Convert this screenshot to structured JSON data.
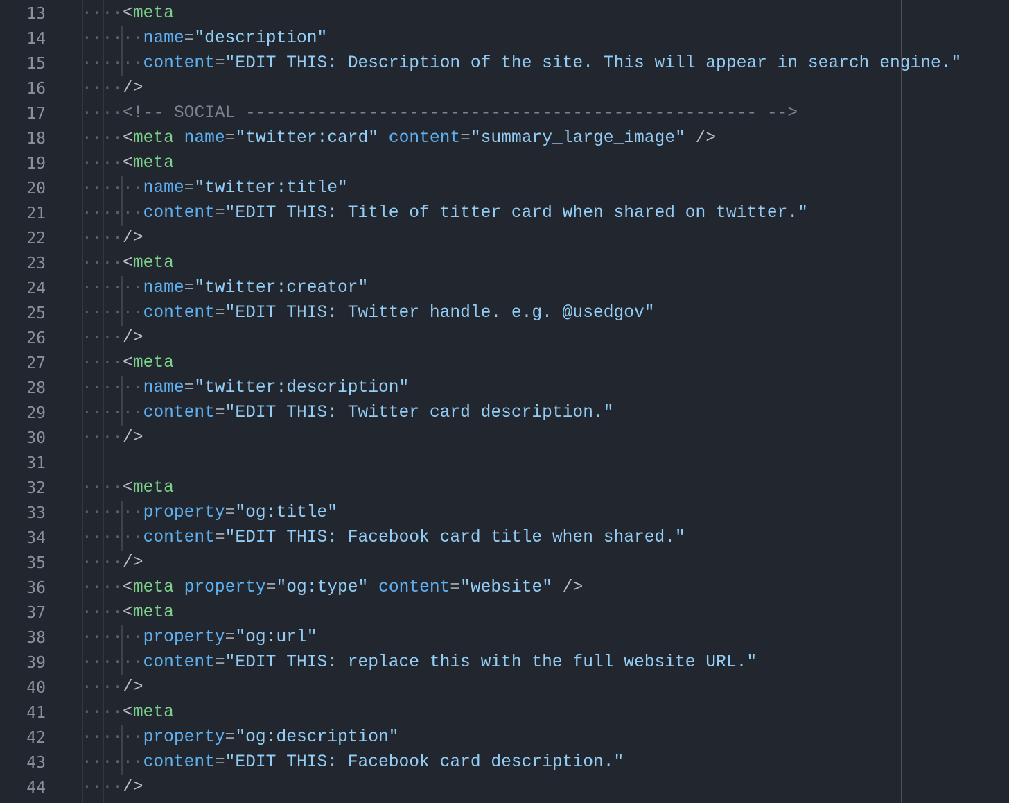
{
  "editor": {
    "first_line_number": 13,
    "lines": [
      {
        "n": "13",
        "indent": 4,
        "tokens": [
          [
            "p",
            "<"
          ],
          [
            "tag",
            "meta"
          ]
        ]
      },
      {
        "n": "14",
        "indent": 6,
        "tokens": [
          [
            "attr",
            "name"
          ],
          [
            "eq",
            "="
          ],
          [
            "str",
            "\"description\""
          ]
        ]
      },
      {
        "n": "15",
        "indent": 6,
        "tokens": [
          [
            "attr",
            "content"
          ],
          [
            "eq",
            "="
          ],
          [
            "str",
            "\"EDIT THIS: Description of the site. This will appear in search engine.\""
          ]
        ]
      },
      {
        "n": "16",
        "indent": 4,
        "tokens": [
          [
            "p",
            "/>"
          ]
        ]
      },
      {
        "n": "17",
        "indent": 4,
        "tokens": [
          [
            "cmt",
            "<!-- SOCIAL -------------------------------------------------- -->"
          ]
        ]
      },
      {
        "n": "18",
        "indent": 4,
        "tokens": [
          [
            "p",
            "<"
          ],
          [
            "tag",
            "meta"
          ],
          [
            "p",
            " "
          ],
          [
            "attr",
            "name"
          ],
          [
            "eq",
            "="
          ],
          [
            "str",
            "\"twitter:card\""
          ],
          [
            "p",
            " "
          ],
          [
            "attr",
            "content"
          ],
          [
            "eq",
            "="
          ],
          [
            "str",
            "\"summary_large_image\""
          ],
          [
            "p",
            " />"
          ]
        ]
      },
      {
        "n": "19",
        "indent": 4,
        "tokens": [
          [
            "p",
            "<"
          ],
          [
            "tag",
            "meta"
          ]
        ]
      },
      {
        "n": "20",
        "indent": 6,
        "tokens": [
          [
            "attr",
            "name"
          ],
          [
            "eq",
            "="
          ],
          [
            "str",
            "\"twitter:title\""
          ]
        ]
      },
      {
        "n": "21",
        "indent": 6,
        "tokens": [
          [
            "attr",
            "content"
          ],
          [
            "eq",
            "="
          ],
          [
            "str",
            "\"EDIT THIS: Title of titter card when shared on twitter.\""
          ]
        ]
      },
      {
        "n": "22",
        "indent": 4,
        "tokens": [
          [
            "p",
            "/>"
          ]
        ]
      },
      {
        "n": "23",
        "indent": 4,
        "tokens": [
          [
            "p",
            "<"
          ],
          [
            "tag",
            "meta"
          ]
        ]
      },
      {
        "n": "24",
        "indent": 6,
        "tokens": [
          [
            "attr",
            "name"
          ],
          [
            "eq",
            "="
          ],
          [
            "str",
            "\"twitter:creator\""
          ]
        ]
      },
      {
        "n": "25",
        "indent": 6,
        "tokens": [
          [
            "attr",
            "content"
          ],
          [
            "eq",
            "="
          ],
          [
            "str",
            "\"EDIT THIS: Twitter handle. e.g. @usedgov\""
          ]
        ]
      },
      {
        "n": "26",
        "indent": 4,
        "tokens": [
          [
            "p",
            "/>"
          ]
        ]
      },
      {
        "n": "27",
        "indent": 4,
        "tokens": [
          [
            "p",
            "<"
          ],
          [
            "tag",
            "meta"
          ]
        ]
      },
      {
        "n": "28",
        "indent": 6,
        "tokens": [
          [
            "attr",
            "name"
          ],
          [
            "eq",
            "="
          ],
          [
            "str",
            "\"twitter:description\""
          ]
        ]
      },
      {
        "n": "29",
        "indent": 6,
        "tokens": [
          [
            "attr",
            "content"
          ],
          [
            "eq",
            "="
          ],
          [
            "str",
            "\"EDIT THIS: Twitter card description.\""
          ]
        ]
      },
      {
        "n": "30",
        "indent": 4,
        "tokens": [
          [
            "p",
            "/>"
          ]
        ]
      },
      {
        "n": "31",
        "indent": 0,
        "tokens": []
      },
      {
        "n": "32",
        "indent": 4,
        "tokens": [
          [
            "p",
            "<"
          ],
          [
            "tag",
            "meta"
          ]
        ]
      },
      {
        "n": "33",
        "indent": 6,
        "tokens": [
          [
            "attr",
            "property"
          ],
          [
            "eq",
            "="
          ],
          [
            "str",
            "\"og:title\""
          ]
        ]
      },
      {
        "n": "34",
        "indent": 6,
        "tokens": [
          [
            "attr",
            "content"
          ],
          [
            "eq",
            "="
          ],
          [
            "str",
            "\"EDIT THIS: Facebook card title when shared.\""
          ]
        ]
      },
      {
        "n": "35",
        "indent": 4,
        "tokens": [
          [
            "p",
            "/>"
          ]
        ]
      },
      {
        "n": "36",
        "indent": 4,
        "tokens": [
          [
            "p",
            "<"
          ],
          [
            "tag",
            "meta"
          ],
          [
            "p",
            " "
          ],
          [
            "attr",
            "property"
          ],
          [
            "eq",
            "="
          ],
          [
            "str",
            "\"og:type\""
          ],
          [
            "p",
            " "
          ],
          [
            "attr",
            "content"
          ],
          [
            "eq",
            "="
          ],
          [
            "str",
            "\"website\""
          ],
          [
            "p",
            " />"
          ]
        ]
      },
      {
        "n": "37",
        "indent": 4,
        "tokens": [
          [
            "p",
            "<"
          ],
          [
            "tag",
            "meta"
          ]
        ]
      },
      {
        "n": "38",
        "indent": 6,
        "tokens": [
          [
            "attr",
            "property"
          ],
          [
            "eq",
            "="
          ],
          [
            "str",
            "\"og:url\""
          ]
        ]
      },
      {
        "n": "39",
        "indent": 6,
        "tokens": [
          [
            "attr",
            "content"
          ],
          [
            "eq",
            "="
          ],
          [
            "str",
            "\"EDIT THIS: replace this with the full website URL.\""
          ]
        ]
      },
      {
        "n": "40",
        "indent": 4,
        "tokens": [
          [
            "p",
            "/>"
          ]
        ]
      },
      {
        "n": "41",
        "indent": 4,
        "tokens": [
          [
            "p",
            "<"
          ],
          [
            "tag",
            "meta"
          ]
        ]
      },
      {
        "n": "42",
        "indent": 6,
        "tokens": [
          [
            "attr",
            "property"
          ],
          [
            "eq",
            "="
          ],
          [
            "str",
            "\"og:description\""
          ]
        ]
      },
      {
        "n": "43",
        "indent": 6,
        "tokens": [
          [
            "attr",
            "content"
          ],
          [
            "eq",
            "="
          ],
          [
            "str",
            "\"EDIT THIS: Facebook card description.\""
          ]
        ]
      },
      {
        "n": "44",
        "indent": 4,
        "tokens": [
          [
            "p",
            "/>"
          ]
        ]
      }
    ]
  }
}
